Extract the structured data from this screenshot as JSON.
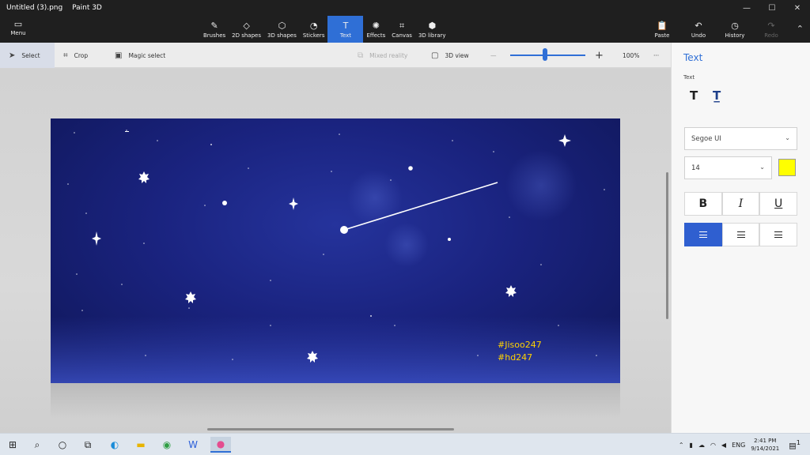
{
  "window": {
    "file_name": "Untitled (3).png",
    "app_name": "Paint 3D",
    "controls": {
      "minimize": "—",
      "maximize": "☐",
      "close": "✕"
    }
  },
  "ribbon": {
    "menu_label": "Menu",
    "tools": [
      {
        "label": "Brushes",
        "icon": "brush-icon",
        "glyph": "✎"
      },
      {
        "label": "2D shapes",
        "icon": "2d-shapes-icon",
        "glyph": "◇"
      },
      {
        "label": "3D shapes",
        "icon": "3d-shapes-icon",
        "glyph": "⬡"
      },
      {
        "label": "Stickers",
        "icon": "stickers-icon",
        "glyph": "◔"
      },
      {
        "label": "Text",
        "icon": "text-icon",
        "glyph": "T"
      },
      {
        "label": "Effects",
        "icon": "effects-icon",
        "glyph": "✺"
      },
      {
        "label": "Canvas",
        "icon": "canvas-icon",
        "glyph": "⌗"
      },
      {
        "label": "3D library",
        "icon": "3d-library-icon",
        "glyph": "⬢"
      }
    ],
    "active_tool": "Text",
    "right_tools": [
      {
        "label": "Paste",
        "icon": "paste-icon",
        "glyph": "📋"
      },
      {
        "label": "Undo",
        "icon": "undo-icon",
        "glyph": "↶"
      },
      {
        "label": "History",
        "icon": "history-icon",
        "glyph": "◷"
      },
      {
        "label": "Redo",
        "icon": "redo-icon",
        "glyph": "↷"
      }
    ]
  },
  "toolbar": {
    "select": "Select",
    "crop": "Crop",
    "magic_select": "Magic select",
    "mixed_reality": "Mixed reality",
    "view_3d": "3D view",
    "zoom_minus": "—",
    "zoom_plus": "+",
    "zoom_level": "100%",
    "more": "···",
    "zoom_fraction": 0.46
  },
  "canvas": {
    "tag1": "#Jisoo247",
    "tag2": "#hd247"
  },
  "panel": {
    "title": "Text",
    "section": "Text",
    "font": "Segoe UI",
    "font_size": "14",
    "text_color": "#ffff00",
    "bold": "B",
    "italic": "I",
    "underline": "U"
  },
  "taskbar": {
    "language": "ENG",
    "time": "2:41 PM",
    "date": "9/14/2021",
    "notifications": "1"
  }
}
